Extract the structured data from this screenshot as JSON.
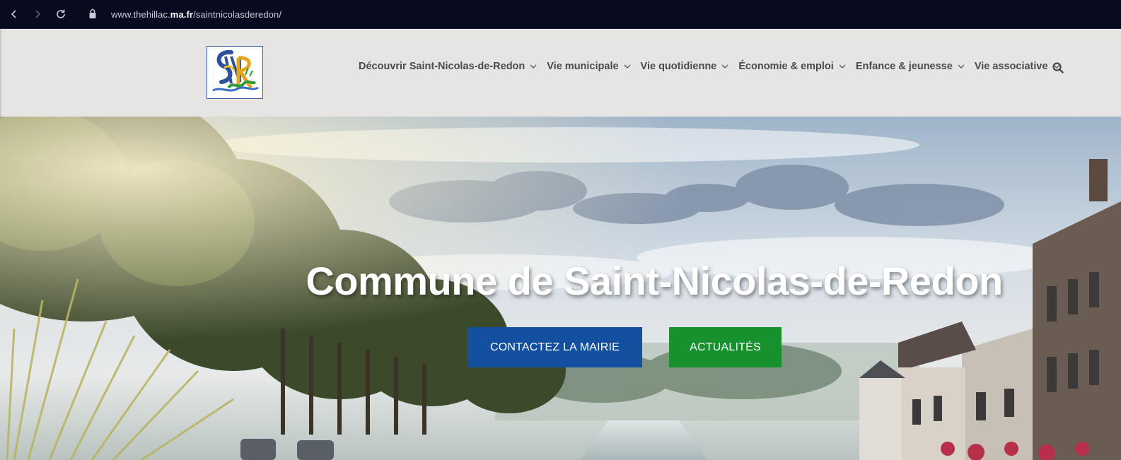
{
  "browser": {
    "url_prefix": "www.thehillac.",
    "url_bold": "ma.fr",
    "url_suffix": "/saintnicolasderedon/",
    "icons": [
      "back-icon",
      "forward-icon",
      "reload-icon",
      "lock-icon"
    ]
  },
  "header": {
    "logo_text": "SNR",
    "menu": [
      {
        "label": "Découvrir Saint-Nicolas-de-Redon"
      },
      {
        "label": "Vie municipale"
      },
      {
        "label": "Vie quotidienne"
      },
      {
        "label": "Économie & emploi"
      },
      {
        "label": "Enfance & jeunesse"
      },
      {
        "label": "Vie associative"
      }
    ],
    "search_icon": "search-icon"
  },
  "hero": {
    "title": "Commune de Saint-Nicolas-de-Redon",
    "contact_button": "CONTACTEZ LA MAIRIE",
    "news_button": "ACTUALITÉS"
  },
  "colors": {
    "browser_bar": "#080a1f",
    "header_bg": "#e7e5e3",
    "contact_button": "#1450a0",
    "news_button": "#17902e",
    "menu_text": "#4a4a4a"
  }
}
